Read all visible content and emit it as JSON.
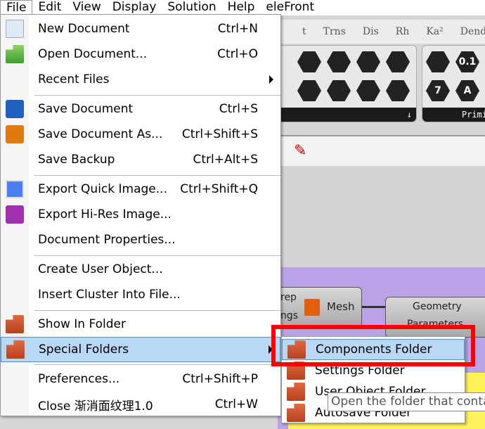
{
  "menubar": [
    "File",
    "Edit",
    "View",
    "Display",
    "Solution",
    "Help",
    "eleFront"
  ],
  "tabs": [
    "t",
    "Trns",
    "Dis",
    "Rh",
    "Ka²",
    "Dendro"
  ],
  "toolbar": {
    "panel_label": "Primi",
    "icons": [
      "0.1",
      "7",
      "A"
    ]
  },
  "canvas": {
    "node1": {
      "label": "Mesh",
      "left_text1": "rep",
      "left_text2": "ngs"
    },
    "node2": {
      "title": "Geometry",
      "sub": "Parameters"
    }
  },
  "file_menu": {
    "items": [
      {
        "label": "New Document",
        "shortcut": "Ctrl+N",
        "icon": "new-document-icon"
      },
      {
        "label": "Open Document...",
        "shortcut": "Ctrl+O",
        "icon": "open-folder-icon"
      },
      {
        "label": "Recent Files",
        "submenu": true
      },
      {
        "label": "Save Document",
        "shortcut": "Ctrl+S",
        "icon": "save-icon"
      },
      {
        "label": "Save Document As...",
        "shortcut": "Ctrl+Shift+S",
        "icon": "save-as-icon"
      },
      {
        "label": "Save Backup",
        "shortcut": "Ctrl+Alt+S"
      },
      {
        "label": "Export Quick Image...",
        "shortcut": "Ctrl+Shift+Q",
        "icon": "quick-image-icon"
      },
      {
        "label": "Export Hi-Res Image...",
        "icon": "hires-image-icon"
      },
      {
        "label": "Document Properties..."
      },
      {
        "label": "Create User Object..."
      },
      {
        "label": "Insert Cluster Into File..."
      },
      {
        "label": "Show In Folder",
        "icon": "folder-icon"
      },
      {
        "label": "Special Folders",
        "icon": "folder-icon",
        "submenu": true,
        "highlighted": true
      },
      {
        "label": "Preferences...",
        "shortcut": "Ctrl+Shift+P"
      },
      {
        "label": "Close 渐消面纹理1.0",
        "shortcut": "Ctrl+W"
      }
    ]
  },
  "special_folders": [
    "Components Folder",
    "Settings Folder",
    "User Object Folder",
    "Autosave Folder"
  ],
  "tooltip": "Open the folder that contains",
  "colors": {
    "highlight": "#b8d8f5",
    "annotation_box": "#ff0000",
    "canvas": "#b9a3e6",
    "group": "#fff25a"
  }
}
